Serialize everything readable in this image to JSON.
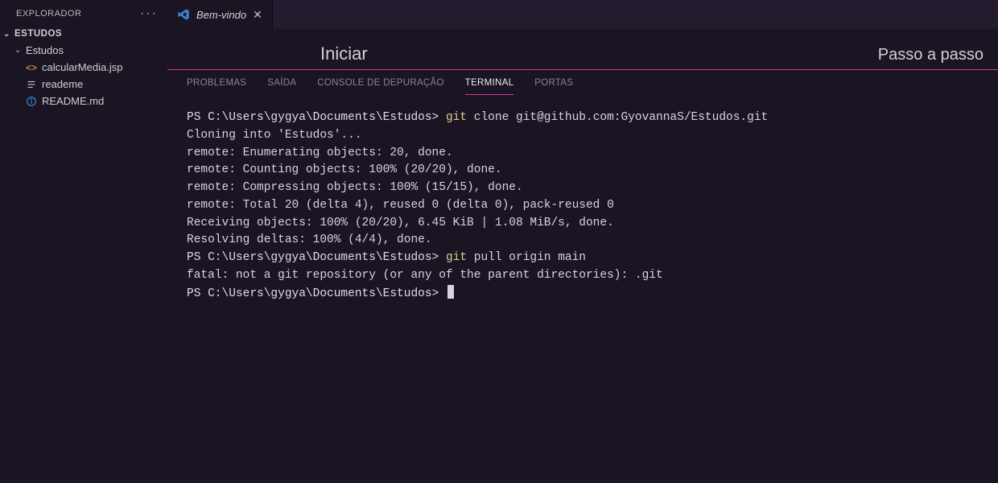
{
  "sidebar": {
    "title": "EXPLORADOR",
    "root": "ESTUDOS",
    "folder": "Estudos",
    "files": [
      {
        "name": "calcularMedia.jsp",
        "iconType": "jsp"
      },
      {
        "name": "reademe",
        "iconType": "text"
      },
      {
        "name": "README.md",
        "iconType": "info"
      }
    ]
  },
  "tab": {
    "label": "Bem-vindo"
  },
  "welcome": {
    "left": "Iniciar",
    "right": "Passo a passo"
  },
  "panels": {
    "items": [
      "PROBLEMAS",
      "SAÍDA",
      "CONSOLE DE DEPURAÇÃO",
      "TERMINAL",
      "PORTAS"
    ],
    "activeIndex": 3
  },
  "terminal": {
    "prompt": "PS C:\\Users\\gygya\\Documents\\Estudos>",
    "cmd1_git": "git",
    "cmd1_rest": " clone git@github.com:GyovannaS/Estudos.git",
    "output": [
      "Cloning into 'Estudos'...",
      "remote: Enumerating objects: 20, done.",
      "remote: Counting objects: 100% (20/20), done.",
      "remote: Compressing objects: 100% (15/15), done.",
      "remote: Total 20 (delta 4), reused 0 (delta 0), pack-reused 0",
      "Receiving objects: 100% (20/20), 6.45 KiB | 1.08 MiB/s, done.",
      "Resolving deltas: 100% (4/4), done."
    ],
    "cmd2_git": "git",
    "cmd2_rest": " pull origin main",
    "error": "fatal: not a git repository (or any of the parent directories): .git"
  }
}
